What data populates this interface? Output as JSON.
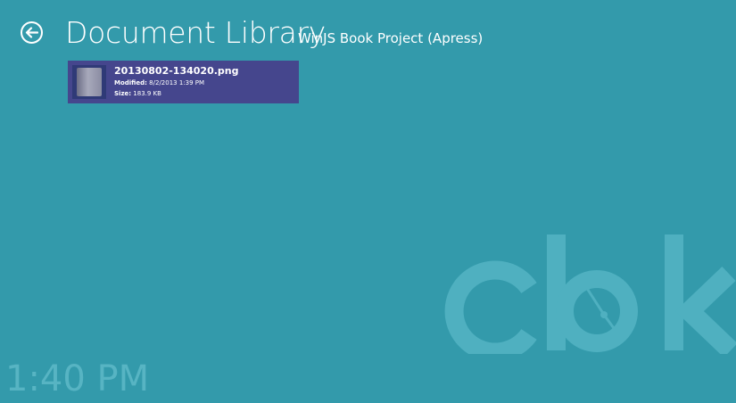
{
  "header": {
    "title": "Document Library",
    "subtitle": "WinJS Book Project (Apress)"
  },
  "back_button": {
    "icon": "arrow-left-icon"
  },
  "files": [
    {
      "name": "20130802-134020.png",
      "modified_label": "Modified:",
      "modified_value": "8/2/2013 1:39 PM",
      "size_label": "Size:",
      "size_value": "183.9 KB"
    }
  ],
  "clock": {
    "time": "1:40 PM"
  },
  "watermark": {
    "logo_text": "clok"
  },
  "colors": {
    "background": "#339aab",
    "tile": "#45468d",
    "watermark": "#4fb0c0",
    "clock_text": "#57b4c3"
  }
}
